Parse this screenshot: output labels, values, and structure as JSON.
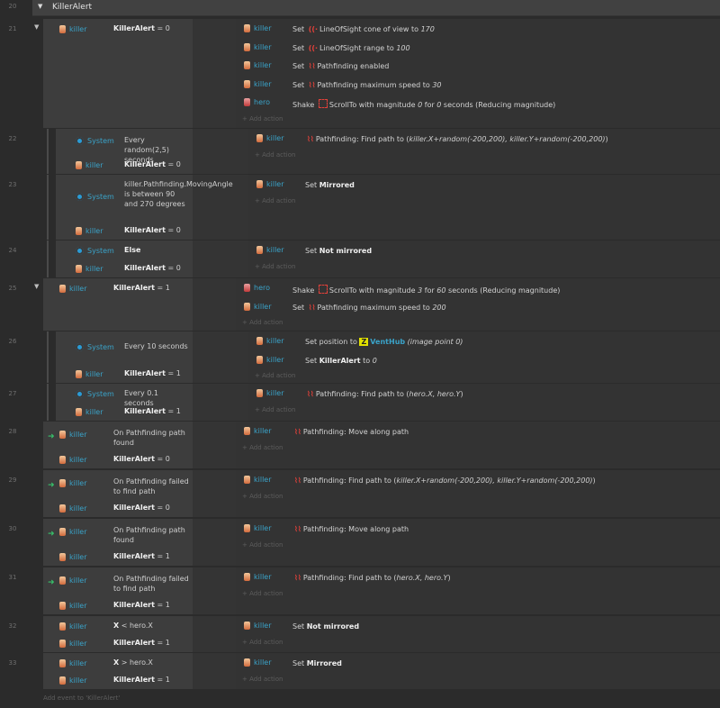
{
  "group": {
    "line": "20",
    "title": "KillerAlert",
    "toggle": "▼"
  },
  "add_action": "+ Add action",
  "footer": "Add event to 'KillerAlert'",
  "events": [
    {
      "line": "21",
      "toggle": "▼",
      "conds": [
        {
          "obj": "killer",
          "text": "KillerAlert = 0"
        }
      ],
      "actions": [
        {
          "obj": "killer",
          "parts": [
            "Set ",
            "icon:sound",
            "LineOfSight cone of view to ",
            "i:170"
          ]
        },
        {
          "obj": "killer",
          "parts": [
            "Set ",
            "icon:sound",
            "LineOfSight range to ",
            "i:100"
          ]
        },
        {
          "obj": "killer",
          "parts": [
            "Set ",
            "icon:path",
            "Pathfinding enabled"
          ]
        },
        {
          "obj": "killer",
          "parts": [
            "Set ",
            "icon:path",
            "Pathfinding maximum speed to ",
            "i:30"
          ]
        },
        {
          "obj": "hero",
          "parts": [
            "Shake ",
            "icon:scroll",
            "ScrollTo with magnitude ",
            "i:0",
            " for ",
            "i:0",
            " seconds (Reducing magnitude)"
          ]
        }
      ]
    },
    {
      "line": "22",
      "conds": [
        {
          "obj": "System",
          "sys": true,
          "text": "Every random(2,5) seconds"
        },
        {
          "obj": "killer",
          "text": "KillerAlert = 0"
        }
      ],
      "actions": [
        {
          "obj": "killer",
          "parts": [
            "icon:path",
            "Pathfinding: Find path to (",
            "i:killer.X+random(-200,200), killer.Y+random(-200,200)",
            ")"
          ]
        }
      ]
    },
    {
      "line": "23",
      "conds": [
        {
          "obj": "System",
          "sys": true,
          "text": "killer.Pathfinding.MovingAngle is between 90 and 270 degrees"
        },
        {
          "obj": "killer",
          "text": "KillerAlert = 0"
        }
      ],
      "actions": [
        {
          "obj": "killer",
          "parts": [
            "Set ",
            "b:Mirrored"
          ]
        }
      ]
    },
    {
      "line": "24",
      "conds": [
        {
          "obj": "System",
          "sys": true,
          "text": "Else"
        },
        {
          "obj": "killer",
          "text": "KillerAlert = 0"
        }
      ],
      "actions": [
        {
          "obj": "killer",
          "parts": [
            "Set ",
            "b:Not mirrored"
          ]
        }
      ]
    },
    {
      "line": "25",
      "toggle": "▼",
      "conds": [
        {
          "obj": "killer",
          "text": "KillerAlert = 1"
        }
      ],
      "actions": [
        {
          "obj": "hero",
          "parts": [
            "Shake ",
            "icon:scroll",
            "ScrollTo with magnitude ",
            "i:3",
            " for ",
            "i:60",
            " seconds (Reducing magnitude)"
          ]
        },
        {
          "obj": "killer",
          "parts": [
            "Set ",
            "icon:path",
            "Pathfinding maximum speed to ",
            "i:200"
          ]
        }
      ]
    },
    {
      "line": "26",
      "conds": [
        {
          "obj": "System",
          "sys": true,
          "text": "Every 10 seconds"
        },
        {
          "obj": "killer",
          "text": "KillerAlert = 1"
        }
      ],
      "actions": [
        {
          "obj": "killer",
          "parts": [
            "Set position to ",
            "icon:z",
            "v:VentHub",
            " ",
            "i:(image point 0)"
          ]
        },
        {
          "obj": "killer",
          "parts": [
            "Set ",
            "b:KillerAlert",
            " to ",
            "i:0"
          ]
        }
      ]
    },
    {
      "line": "27",
      "conds": [
        {
          "obj": "System",
          "sys": true,
          "text": "Every 0.1 seconds"
        },
        {
          "obj": "killer",
          "text": "KillerAlert = 1"
        }
      ],
      "actions": [
        {
          "obj": "killer",
          "parts": [
            "icon:path",
            "Pathfinding: Find path to (",
            "i:hero.X, hero.Y",
            ")"
          ]
        }
      ]
    },
    {
      "line": "28",
      "trigger": true,
      "conds": [
        {
          "obj": "killer",
          "text": "On Pathfinding path found"
        },
        {
          "obj": "killer",
          "text": "KillerAlert = 0"
        }
      ],
      "actions": [
        {
          "obj": "killer",
          "parts": [
            "icon:path",
            "Pathfinding: Move along path"
          ]
        }
      ]
    },
    {
      "line": "29",
      "trigger": true,
      "conds": [
        {
          "obj": "killer",
          "text": "On Pathfinding failed to find path"
        },
        {
          "obj": "killer",
          "text": "KillerAlert = 0"
        }
      ],
      "actions": [
        {
          "obj": "killer",
          "parts": [
            "icon:path",
            "Pathfinding: Find path to (",
            "i:killer.X+random(-200,200), killer.Y+random(-200,200)",
            ")"
          ]
        }
      ]
    },
    {
      "line": "30",
      "trigger": true,
      "conds": [
        {
          "obj": "killer",
          "text": "On Pathfinding path found"
        },
        {
          "obj": "killer",
          "text": "KillerAlert = 1"
        }
      ],
      "actions": [
        {
          "obj": "killer",
          "parts": [
            "icon:path",
            "Pathfinding: Move along path"
          ]
        }
      ]
    },
    {
      "line": "31",
      "trigger": true,
      "conds": [
        {
          "obj": "killer",
          "text": "On Pathfinding failed to find path"
        },
        {
          "obj": "killer",
          "text": "KillerAlert = 1"
        }
      ],
      "actions": [
        {
          "obj": "killer",
          "parts": [
            "icon:path",
            "Pathfinding: Find path to (",
            "i:hero.X, hero.Y",
            ")"
          ]
        }
      ]
    },
    {
      "line": "32",
      "conds": [
        {
          "obj": "killer",
          "text": "X < hero.X"
        },
        {
          "obj": "killer",
          "text": "KillerAlert = 1"
        }
      ],
      "actions": [
        {
          "obj": "killer",
          "parts": [
            "Set ",
            "b:Not mirrored"
          ]
        }
      ]
    },
    {
      "line": "33",
      "conds": [
        {
          "obj": "killer",
          "text": "X > hero.X"
        },
        {
          "obj": "killer",
          "text": "KillerAlert = 1"
        }
      ],
      "actions": [
        {
          "obj": "killer",
          "parts": [
            "Set ",
            "b:Mirrored"
          ]
        }
      ]
    }
  ]
}
